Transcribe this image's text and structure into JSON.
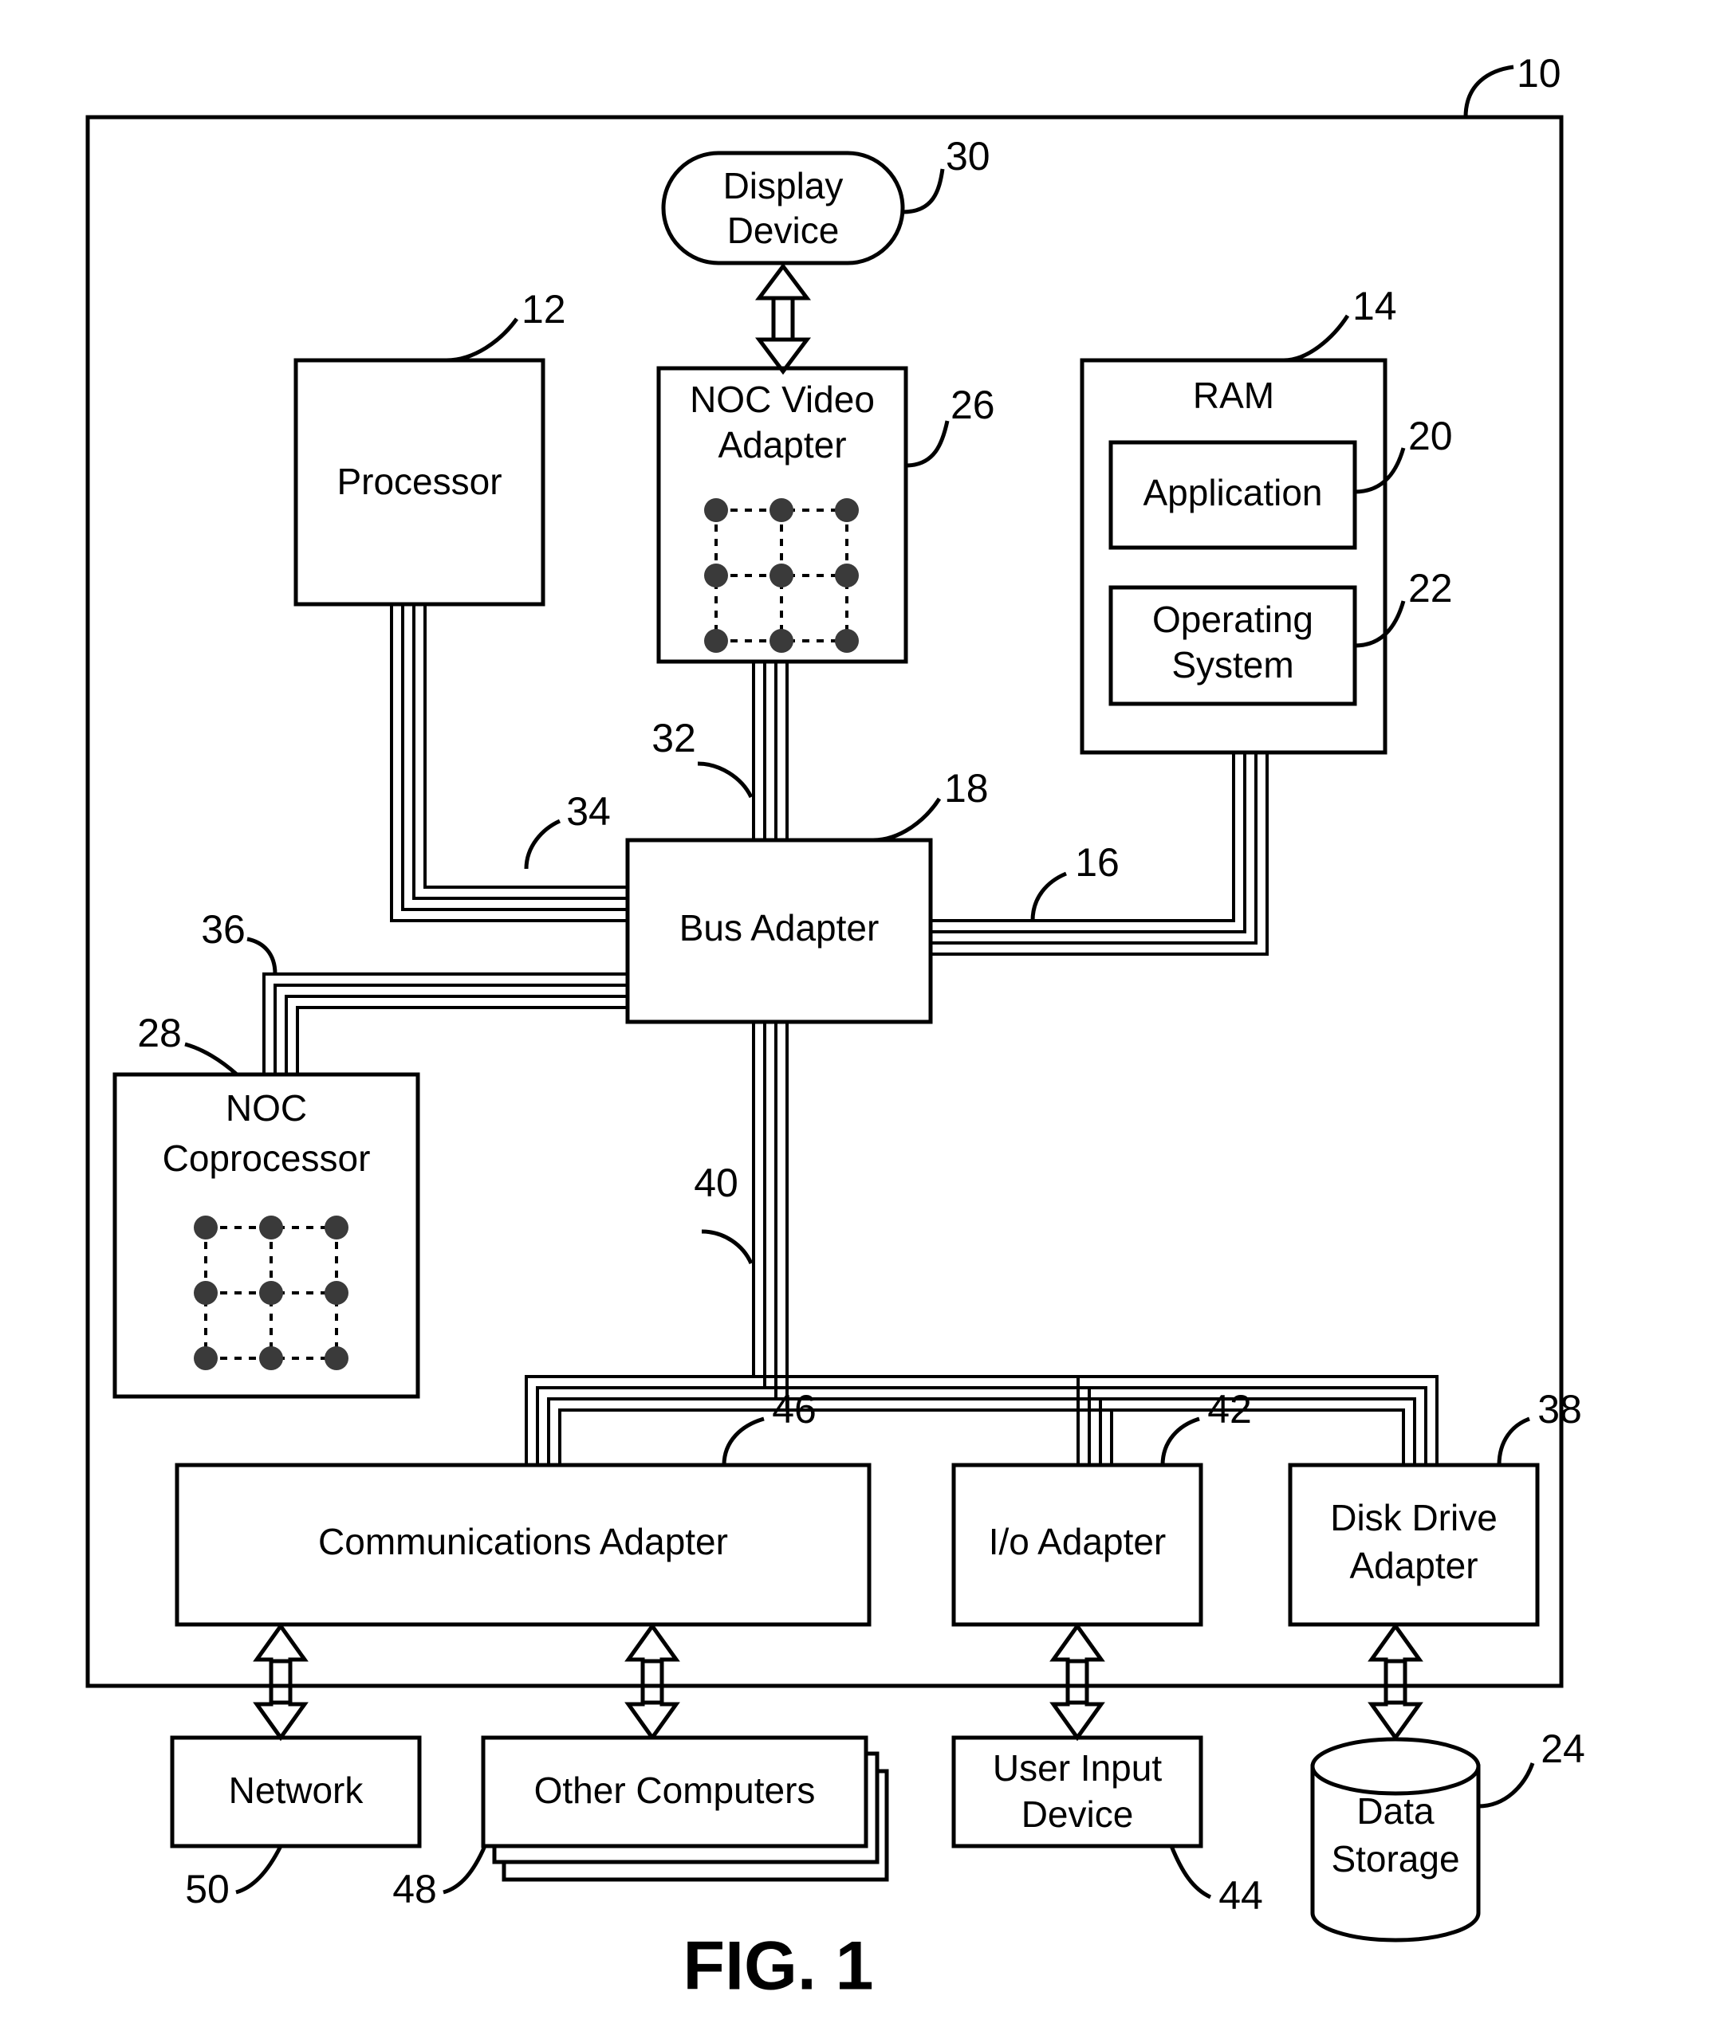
{
  "figure": {
    "caption": "FIG. 1",
    "outer_ref": "10"
  },
  "blocks": {
    "display_device": {
      "label_line1": "Display",
      "label_line2": "Device",
      "ref": "30",
      "shape": "rounded-oval"
    },
    "noc_video_adapter": {
      "label_line1": "NOC Video",
      "label_line2": "Adapter",
      "ref": "26",
      "shape": "rect-with-mesh"
    },
    "processor": {
      "label": "Processor",
      "ref": "12",
      "shape": "rect"
    },
    "ram": {
      "label": "RAM",
      "ref": "14",
      "shape": "rect"
    },
    "application": {
      "label": "Application",
      "ref": "20",
      "shape": "rect"
    },
    "operating_system": {
      "label_line1": "Operating",
      "label_line2": "System",
      "ref": "22",
      "shape": "rect"
    },
    "bus_adapter": {
      "label": "Bus Adapter",
      "ref": "18",
      "shape": "rect"
    },
    "noc_coprocessor": {
      "label_line1": "NOC",
      "label_line2": "Coprocessor",
      "ref": "28",
      "shape": "rect-with-mesh"
    },
    "communications_adapter": {
      "label": "Communications Adapter",
      "ref": "46",
      "shape": "rect"
    },
    "io_adapter": {
      "label": "I/o Adapter",
      "ref": "42",
      "shape": "rect"
    },
    "disk_drive_adapter": {
      "label_line1": "Disk Drive",
      "label_line2": "Adapter",
      "ref": "38",
      "shape": "rect"
    },
    "network": {
      "label": "Network",
      "ref": "50",
      "shape": "rect"
    },
    "other_computers": {
      "label": "Other Computers",
      "ref": "48",
      "shape": "stacked-rect"
    },
    "user_input_device": {
      "label_line1": "User Input",
      "label_line2": "Device",
      "ref": "44",
      "shape": "rect"
    },
    "data_storage": {
      "label_line1": "Data",
      "label_line2": "Storage",
      "ref": "24",
      "shape": "cylinder"
    }
  },
  "bus_refs": {
    "ram_bus": "16",
    "video_bus": "32",
    "processor_bus": "34",
    "coprocessor_bus": "36",
    "expansion_bus": "40"
  }
}
